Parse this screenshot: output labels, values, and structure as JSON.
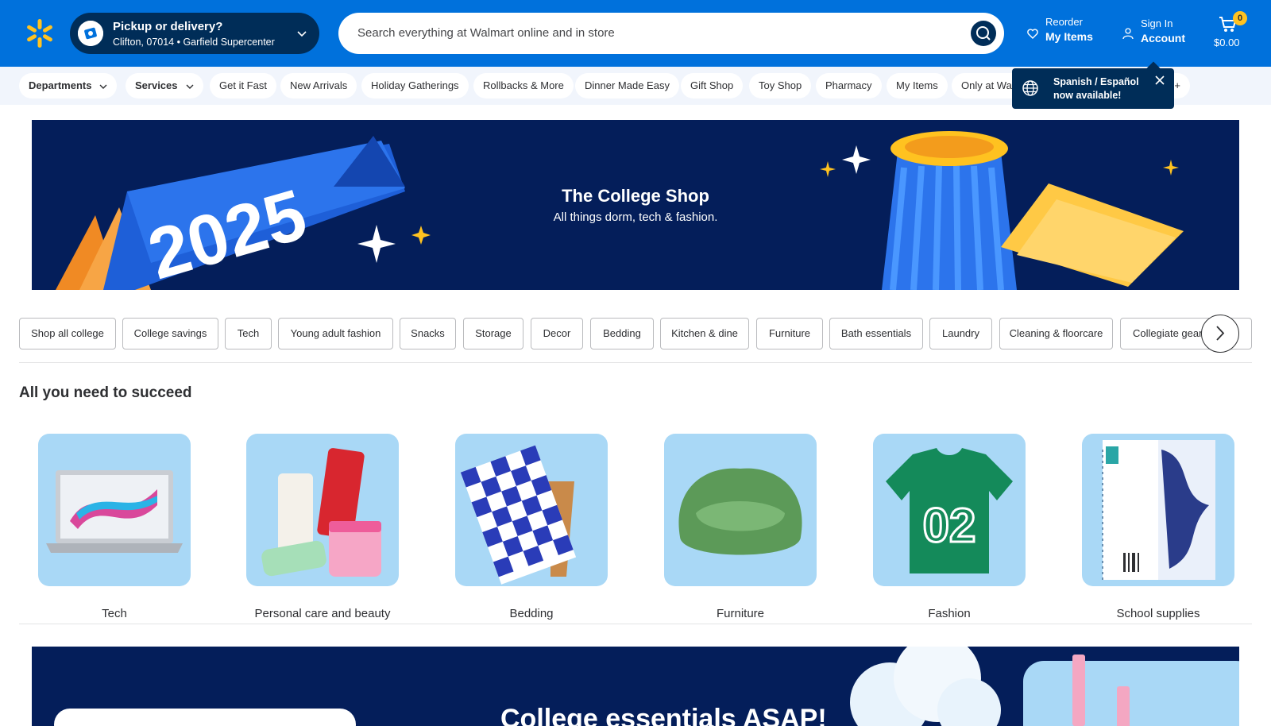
{
  "header": {
    "pickup_title": "Pickup or delivery?",
    "pickup_subtitle": "Clifton, 07014 • Garfield Supercenter",
    "search_placeholder": "Search everything at Walmart online and in store",
    "reorder_small": "Reorder",
    "reorder_big": "My Items",
    "signin_small": "Sign In",
    "signin_big": "Account",
    "cart_count": "0",
    "cart_total": "$0.00",
    "brand_color": "#0071dc",
    "spark_color": "#ffc220"
  },
  "nav": {
    "departments": "Departments",
    "services": "Services",
    "items": [
      "Get it Fast",
      "New Arrivals",
      "Holiday Gatherings",
      "Rollbacks & More",
      "Dinner Made Easy",
      "Gift Shop",
      "Toy Shop",
      "Pharmacy",
      "My Items",
      "Only at Walmart"
    ],
    "more_fragment": "+"
  },
  "lang_popup": {
    "line1": "Spanish / Español",
    "line2": "now available!"
  },
  "hero": {
    "title": "The College Shop",
    "subtitle": "All things dorm, tech & fashion.",
    "banner_text": "2025"
  },
  "chips": [
    "Shop all college",
    "College savings",
    "Tech",
    "Young adult fashion",
    "Snacks",
    "Storage",
    "Decor",
    "Bedding",
    "Kitchen & dine",
    "Furniture",
    "Bath essentials",
    "Laundry",
    "Cleaning & floorcare",
    "Collegiate gear"
  ],
  "section": {
    "title": "All you need to succeed",
    "tiles": [
      "Tech",
      "Personal care and beauty",
      "Bedding",
      "Furniture",
      "Fashion",
      "School supplies"
    ]
  },
  "promo": {
    "title": "College essentials ASAP!"
  }
}
